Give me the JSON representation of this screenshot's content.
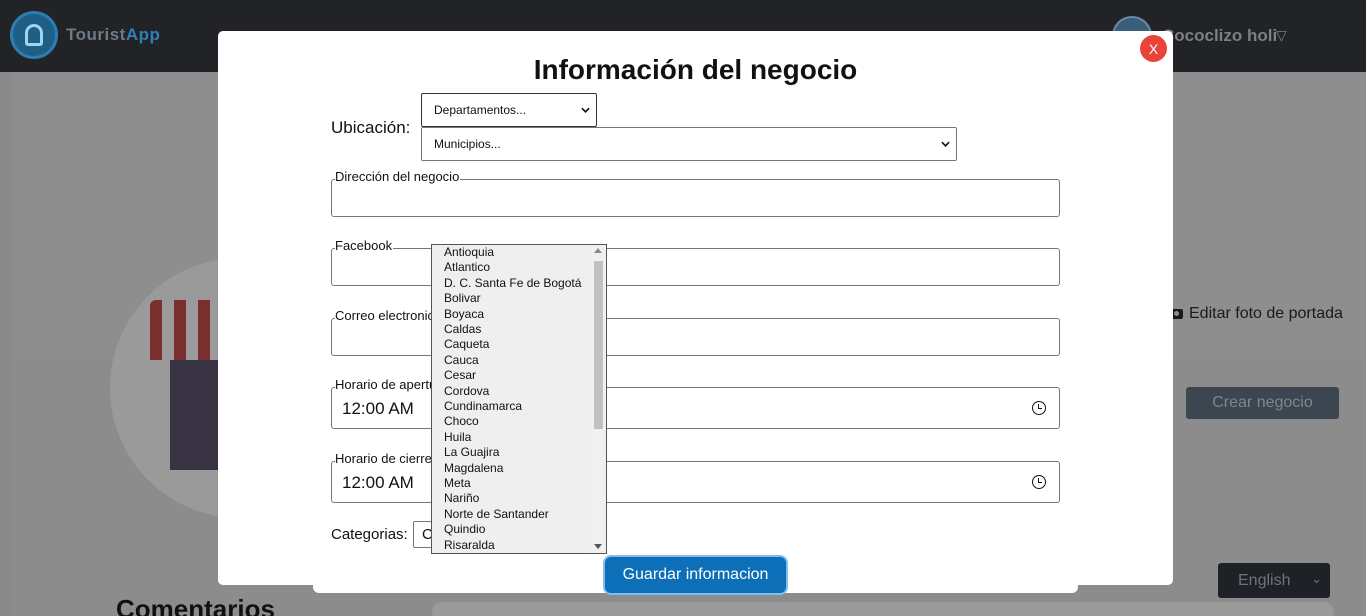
{
  "header": {
    "brand_part1": "Tourist",
    "brand_part2": "App",
    "user_name": "Cococlizo holi",
    "user_caret": "▽"
  },
  "page": {
    "edit_cover_label": "Editar foto de portada",
    "create_business_label": "Crear negocio",
    "language_selected": "English",
    "comments_title": "Comentarios"
  },
  "modal": {
    "title": "Información del negocio",
    "close_label": "X",
    "location_label": "Ubicación:",
    "departments_placeholder": "Departamentos...",
    "municipalities_placeholder": "Municipios...",
    "address_label": "Dirección del negocio",
    "facebook_label": "Facebook",
    "email_label": "Correo electronico",
    "opening_label": "Horario de apertura",
    "opening_value": "12:00 AM",
    "closing_label": "Horario de cierre",
    "closing_value": "12:00 AM",
    "categories_label": "Categorias:",
    "categories_value": "C",
    "save_label": "Guardar informacion"
  },
  "departments_list": [
    "Antioquia",
    "Atlantico",
    "D. C. Santa Fe de Bogotá",
    "Bolivar",
    "Boyaca",
    "Caldas",
    "Caqueta",
    "Cauca",
    "Cesar",
    "Cordova",
    "Cundinamarca",
    "Choco",
    "Huila",
    "La Guajira",
    "Magdalena",
    "Meta",
    "Nariño",
    "Norte de Santander",
    "Quindio",
    "Risaralda"
  ],
  "colors": {
    "primary": "#0d6fb8",
    "close": "#e8443a",
    "topbar": "#222326"
  }
}
